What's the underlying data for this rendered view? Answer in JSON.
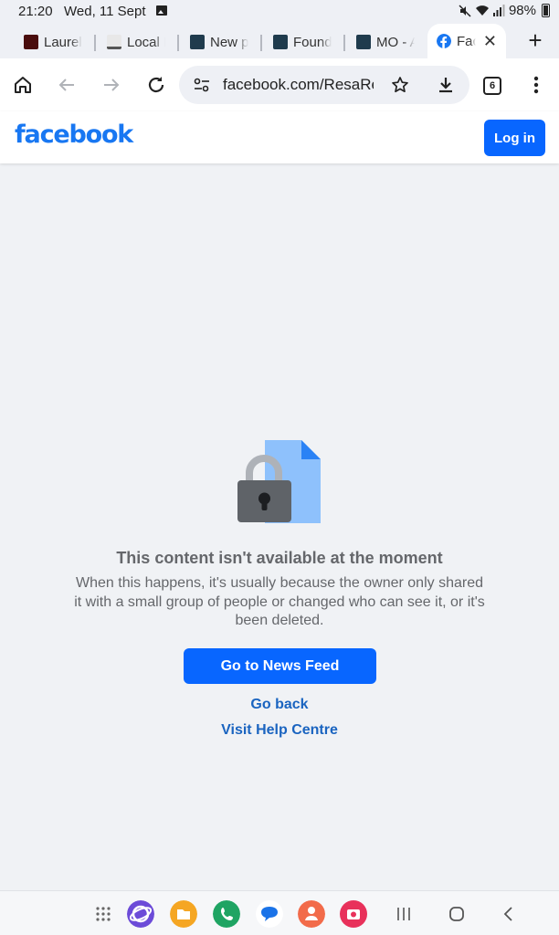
{
  "status_bar": {
    "time": "21:20",
    "date": "Wed, 11 Sept",
    "battery": "98%",
    "icons": [
      "image-notification-icon",
      "mute-icon",
      "wifi-icon",
      "signal-icon",
      "battery-icon"
    ]
  },
  "tabs": [
    {
      "label": "Laurel",
      "favicon": "red-square"
    },
    {
      "label": "Local N",
      "favicon": "grey-logo"
    },
    {
      "label": "New p",
      "favicon": "chart-thumb"
    },
    {
      "label": "Found",
      "favicon": "chart-thumb"
    },
    {
      "label": "MO - A",
      "favicon": "chart-thumb"
    },
    {
      "label": "Face",
      "favicon": "facebook-icon",
      "active": true
    }
  ],
  "toolbar": {
    "url": "facebook.com/ResaRe",
    "tab_count": "6"
  },
  "header": {
    "logo": "facebook",
    "login_label": "Log in"
  },
  "content": {
    "title": "This content isn't available at the moment",
    "message": "When this happens, it's usually because the owner only shared it with a small group of people or changed who can see it, or it's been deleted.",
    "news_feed_label": "Go to News Feed",
    "go_back_label": "Go back",
    "help_label": "Visit Help Centre"
  },
  "colors": {
    "brand": "#1877f2",
    "button": "#0866ff",
    "link": "#1a64c0",
    "text_secondary": "#65676b",
    "page_bg": "#f0f2f5"
  },
  "navbar": {
    "apps": [
      "app-drawer-icon",
      "internet-app-icon",
      "my-files-icon",
      "phone-app-icon",
      "messages-app-icon",
      "contacts-app-icon",
      "screen-recorder-icon"
    ],
    "buttons": [
      "recents-button",
      "home-button",
      "back-button"
    ]
  }
}
